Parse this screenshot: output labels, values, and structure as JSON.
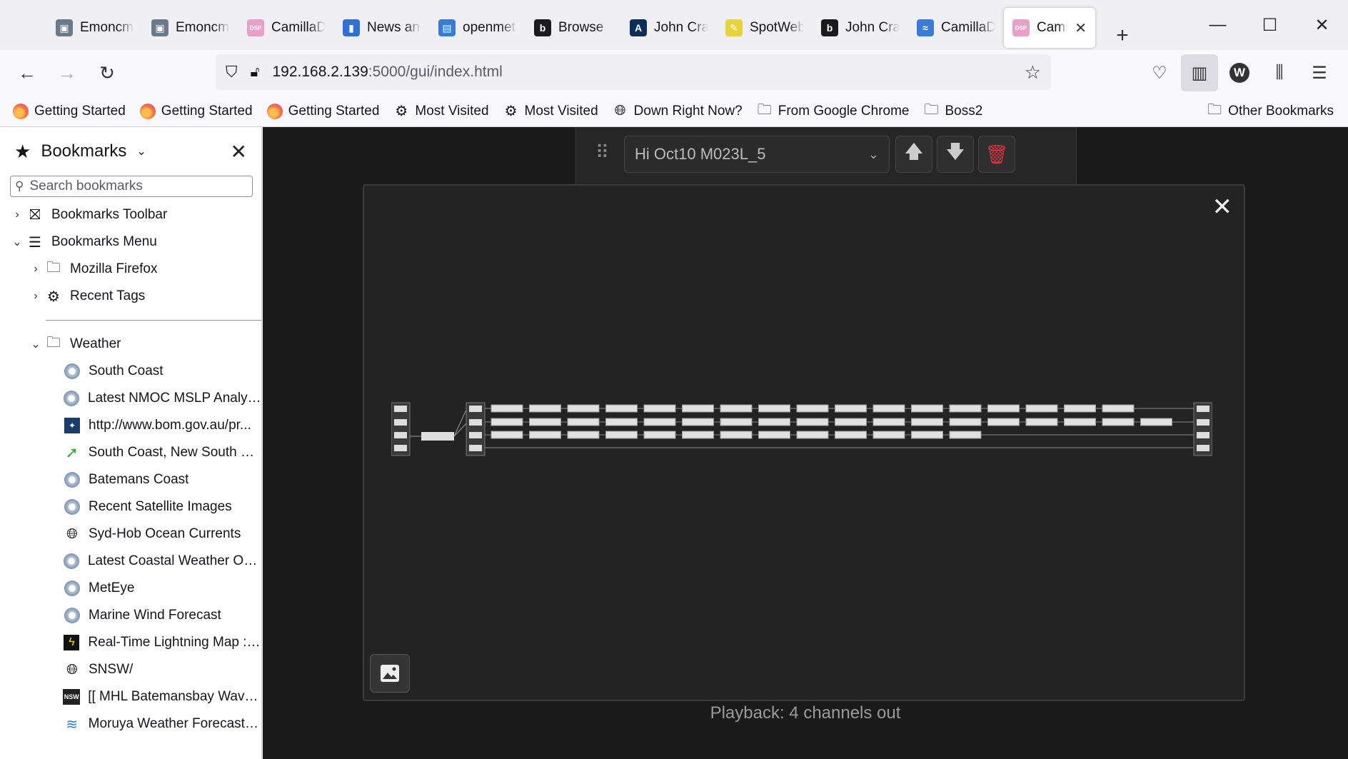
{
  "tabs": [
    {
      "title": "Emoncms",
      "fav": "#6b7a8a",
      "glyph": "▣"
    },
    {
      "title": "Emoncms",
      "fav": "#6b7a8a",
      "glyph": "▣"
    },
    {
      "title": "CamillaDSP",
      "fav": "#e8a0c8",
      "glyph": "DSP"
    },
    {
      "title": "News and",
      "fav": "#2f6fd6",
      "glyph": "▮"
    },
    {
      "title": "openmeteo",
      "fav": "#3a7bd5",
      "glyph": "▤"
    },
    {
      "title": "Browse",
      "fav": "#1b1b1b",
      "glyph": "b"
    },
    {
      "title": "John Cra",
      "fav": "#0c2d5a",
      "glyph": "A"
    },
    {
      "title": "SpotWeb",
      "fav": "#e8d33a",
      "glyph": "✎"
    },
    {
      "title": "John Cra",
      "fav": "#1b1b1b",
      "glyph": "b"
    },
    {
      "title": "CamillaDSP",
      "fav": "#3a7bd5",
      "glyph": "≈"
    },
    {
      "title": "CamillaDSP",
      "fav": "#e8a0c8",
      "glyph": "DSP",
      "active": true
    }
  ],
  "url": {
    "host": "192.168.2.139",
    "path": ":5000/gui/index.html"
  },
  "bookmarks_toolbar": [
    {
      "label": "Getting Started",
      "icon": "firefox"
    },
    {
      "label": "Getting Started",
      "icon": "firefox"
    },
    {
      "label": "Getting Started",
      "icon": "firefox"
    },
    {
      "label": "Most Visited",
      "icon": "gear"
    },
    {
      "label": "Most Visited",
      "icon": "gear"
    },
    {
      "label": "Down Right Now?",
      "icon": "globe"
    },
    {
      "label": "From Google Chrome",
      "icon": "folder"
    },
    {
      "label": "Boss2",
      "icon": "folder"
    }
  ],
  "other_bookmarks": "Other Bookmarks",
  "sidebar": {
    "title": "Bookmarks",
    "search_placeholder": "Search bookmarks",
    "top": [
      {
        "label": "Bookmarks Toolbar",
        "icon": "star-box",
        "twisty": "›",
        "indent": 0
      },
      {
        "label": "Bookmarks Menu",
        "icon": "menu",
        "twisty": "⌄",
        "indent": 0
      },
      {
        "label": "Mozilla Firefox",
        "icon": "folder",
        "twisty": "›",
        "indent": 1
      },
      {
        "label": "Recent Tags",
        "icon": "gear",
        "twisty": "›",
        "indent": 1
      }
    ],
    "weather_folder": "Weather",
    "weather": [
      {
        "label": "South Coast",
        "icon": "bom"
      },
      {
        "label": "Latest NMOC MSLP Analysi...",
        "icon": "bom"
      },
      {
        "label": "http://www.bom.gov.au/pr...",
        "icon": "bom-crest"
      },
      {
        "label": "South Coast, New South W...",
        "icon": "arrow"
      },
      {
        "label": "Batemans Coast",
        "icon": "bom"
      },
      {
        "label": "Recent Satellite Images",
        "icon": "bom"
      },
      {
        "label": "Syd-Hob Ocean Currents",
        "icon": "globe"
      },
      {
        "label": "Latest Coastal Weather Obs...",
        "icon": "bom"
      },
      {
        "label": "MetEye",
        "icon": "bom"
      },
      {
        "label": "Marine Wind Forecast",
        "icon": "bom"
      },
      {
        "label": "Real-Time Lightning Map :: ...",
        "icon": "bolt"
      },
      {
        "label": "SNSW/",
        "icon": "globe"
      },
      {
        "label": "[[ MHL Batemansbay Wave ...",
        "icon": "nsw"
      },
      {
        "label": "Moruya Weather Forecast, ...",
        "icon": "wind"
      }
    ]
  },
  "content": {
    "filter_select": "Hi Oct10 M023L_5",
    "caption": "Playback: 4 channels out"
  }
}
